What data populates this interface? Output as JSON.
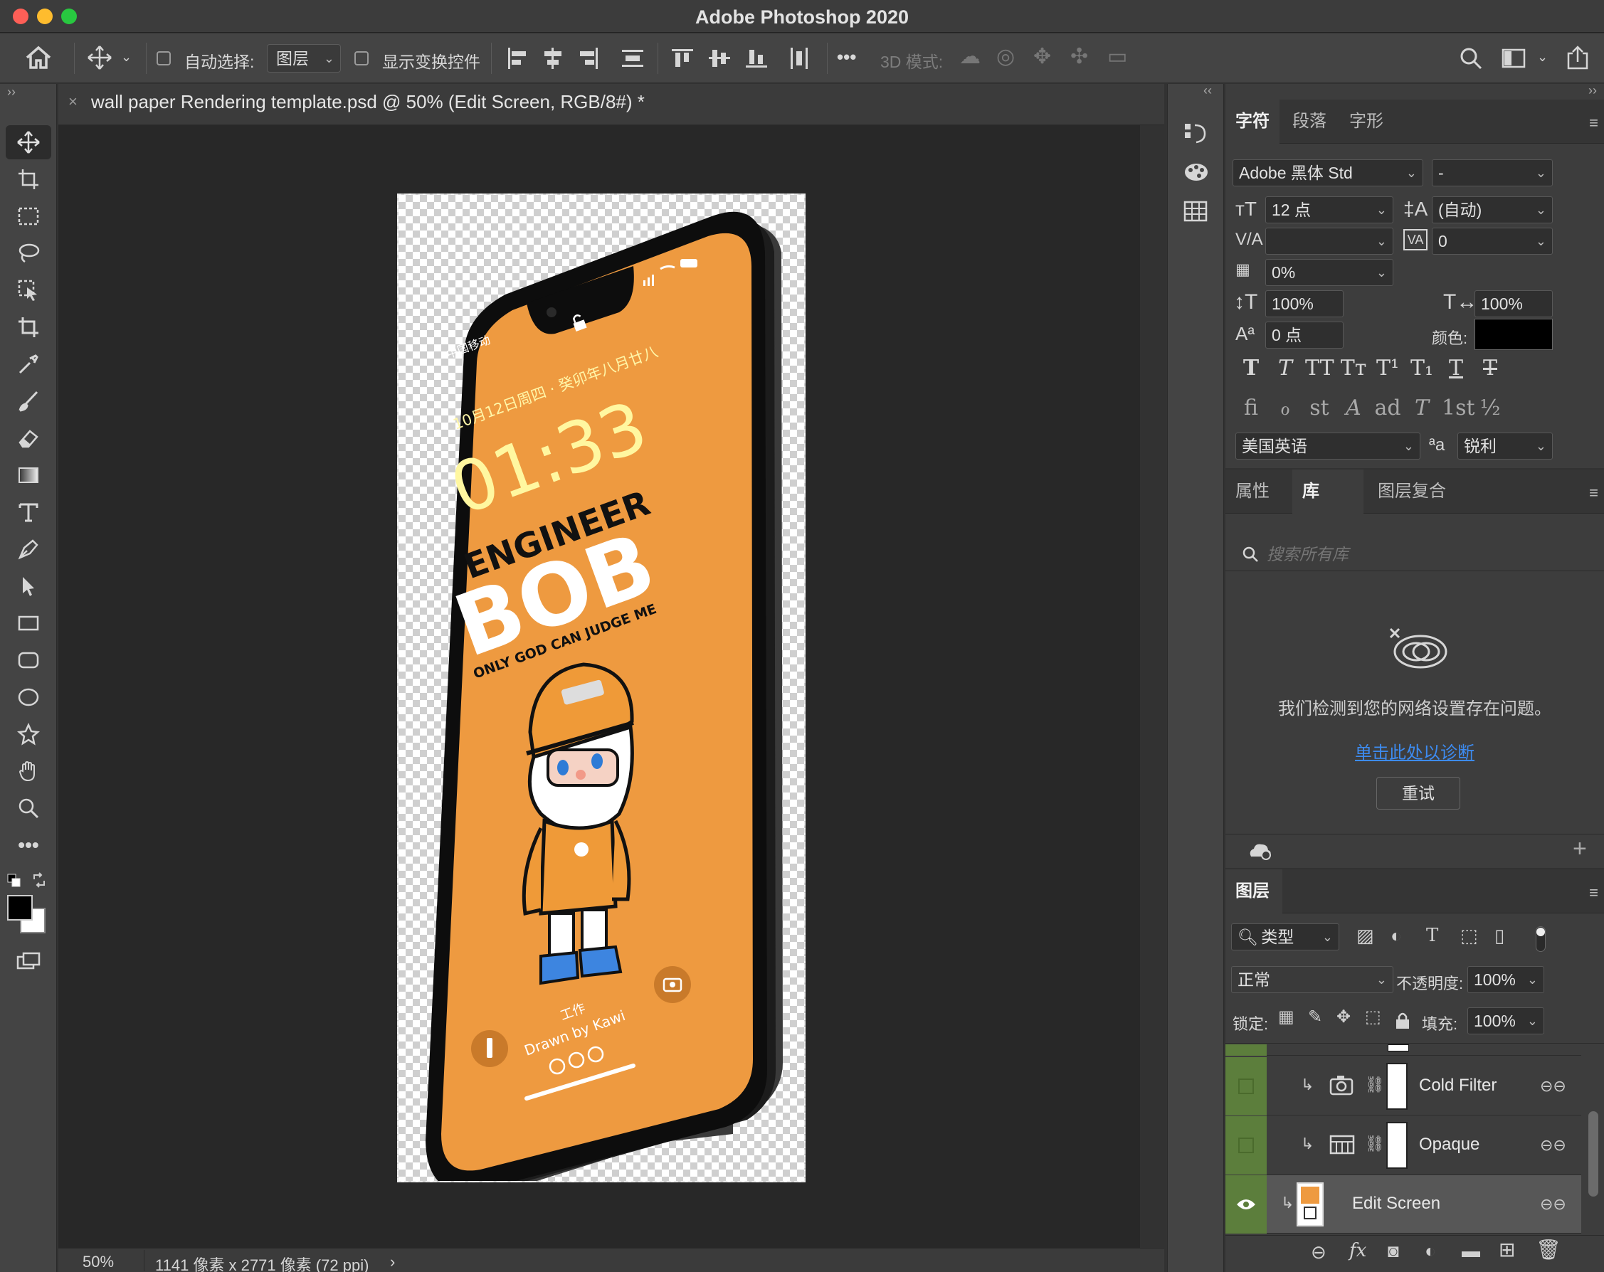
{
  "app": {
    "title": "Adobe Photoshop 2020"
  },
  "options_bar": {
    "auto_select_label": "自动选择:",
    "auto_select_value": "图层",
    "show_transform_label": "显示变换控件",
    "more_label": "•••",
    "mode_3d_label": "3D 模式:"
  },
  "document": {
    "tab_title": "wall paper Rendering template.psd @ 50% (Edit Screen, RGB/8#) *",
    "zoom": "50%",
    "size_info": "1141 像素 x 2771 像素 (72 ppi)"
  },
  "phone": {
    "carrier": "中国移动",
    "date": "10月12日周四 · 癸卯年八月廿八",
    "time": "01:33",
    "line1": "ENGINEER",
    "line2": "BOB",
    "line3": "ONLY GOD CAN JUDGE ME",
    "focus": "工作",
    "credit": "Drawn by Kawi"
  },
  "character_panel": {
    "tabs": [
      "字符",
      "段落",
      "字形"
    ],
    "font_family": "Adobe 黑体 Std",
    "font_style": "-",
    "font_size": "12 点",
    "leading": "(自动)",
    "kerning": "",
    "tracking": "0",
    "tsume": "0%",
    "vertical_scale": "100%",
    "horizontal_scale": "100%",
    "baseline_shift": "0 点",
    "color_label": "颜色:",
    "color_value": "#000000",
    "style_buttons": [
      "T",
      "T",
      "TT",
      "Tт",
      "T¹",
      "T₁",
      "T",
      "T"
    ],
    "opentype_buttons": [
      "ﬁ",
      "ℴ",
      "st",
      "A",
      "ad",
      "T",
      "1st",
      "½"
    ],
    "language": "美国英语",
    "aa_label": "ªa",
    "antialias": "锐利"
  },
  "library_panel": {
    "tabs": [
      "属性",
      "库",
      "图层复合"
    ],
    "search_placeholder": "搜索所有库",
    "error_message": "我们检测到您的网络设置存在问题。",
    "diagnose_link": "单击此处以诊断",
    "retry_button": "重试"
  },
  "layers_panel": {
    "tab": "图层",
    "filter_kind": "类型",
    "blend_mode": "正常",
    "opacity_label": "不透明度:",
    "opacity_value": "100%",
    "lock_label": "锁定:",
    "fill_label": "填充:",
    "fill_value": "100%",
    "layers": [
      {
        "name": "Cold Filter",
        "visible": false,
        "selected": false
      },
      {
        "name": "Opaque",
        "visible": false,
        "selected": false
      },
      {
        "name": "Edit Screen",
        "visible": true,
        "selected": true
      }
    ]
  },
  "colors": {
    "phone_screen": "#ee9a40",
    "time_text": "#fff7a0",
    "link_blue": "#3d8bf0",
    "layer_green": "#5c7e3c"
  }
}
